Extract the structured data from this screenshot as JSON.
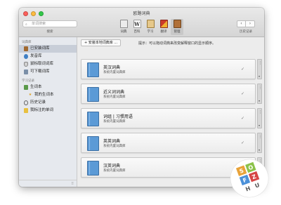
{
  "window": {
    "title": "欧路词典"
  },
  "search": {
    "placeholder": "单词搜索",
    "label": "搜索"
  },
  "toolbar": {
    "items": [
      {
        "label": "词典",
        "icon": "dictionary-icon"
      },
      {
        "label": "百科",
        "icon": "wikipedia-icon",
        "glyph": "W"
      },
      {
        "label": "学习",
        "icon": "learn-icon"
      },
      {
        "label": "翻译",
        "icon": "translate-icon"
      },
      {
        "label": "管理",
        "icon": "manage-icon",
        "active": true
      }
    ],
    "history_label": "历史记录",
    "back": "‹",
    "forward": "›"
  },
  "sidebar": {
    "section1": "词典库",
    "items1": [
      {
        "label": "已安装词库",
        "icon": "library-icon",
        "active": true
      },
      {
        "label": "发音库",
        "icon": "speaker-icon"
      },
      {
        "label": "鼠标取词词库",
        "icon": "mouse-icon"
      },
      {
        "label": "可下载词库",
        "icon": "download-icon"
      }
    ],
    "section2": "学习记录",
    "items2": [
      {
        "label": "生词本",
        "icon": "notebook-icon",
        "sub": false
      },
      {
        "label": "我的生词本",
        "icon": "star-icon",
        "sub": true
      },
      {
        "label": "历史记录",
        "icon": "clock-icon",
        "sub": false
      },
      {
        "label": "我标注的单词",
        "icon": "highlight-icon",
        "sub": false
      }
    ]
  },
  "content": {
    "add_button": "+ 安装本地词典库 ...",
    "hint": "提示：可以拖动词典来改变解释窗口的显示顺序。",
    "dictionaries": [
      {
        "name": "英汉词典",
        "desc": "系统内置词典库",
        "checked": "✓"
      },
      {
        "name": "近义词词典",
        "desc": "系统内置词典库",
        "checked": "✓"
      },
      {
        "name": "词组 | 习惯用语",
        "desc": "系统内置词典库",
        "checked": "✓"
      },
      {
        "name": "英英词典",
        "desc": "系统内置词典库",
        "checked": "✓"
      },
      {
        "name": "汉英词典",
        "desc": "系统内置词典库",
        "checked": "✓"
      }
    ]
  },
  "watermark": {
    "letters": [
      "S",
      "O",
      "F",
      "Z",
      "H",
      "U"
    ]
  },
  "colors": {
    "accent_book": "#5b9ad6",
    "active_tool": "#c8c8c8",
    "sidebar_bg": "#e6e9ee"
  }
}
